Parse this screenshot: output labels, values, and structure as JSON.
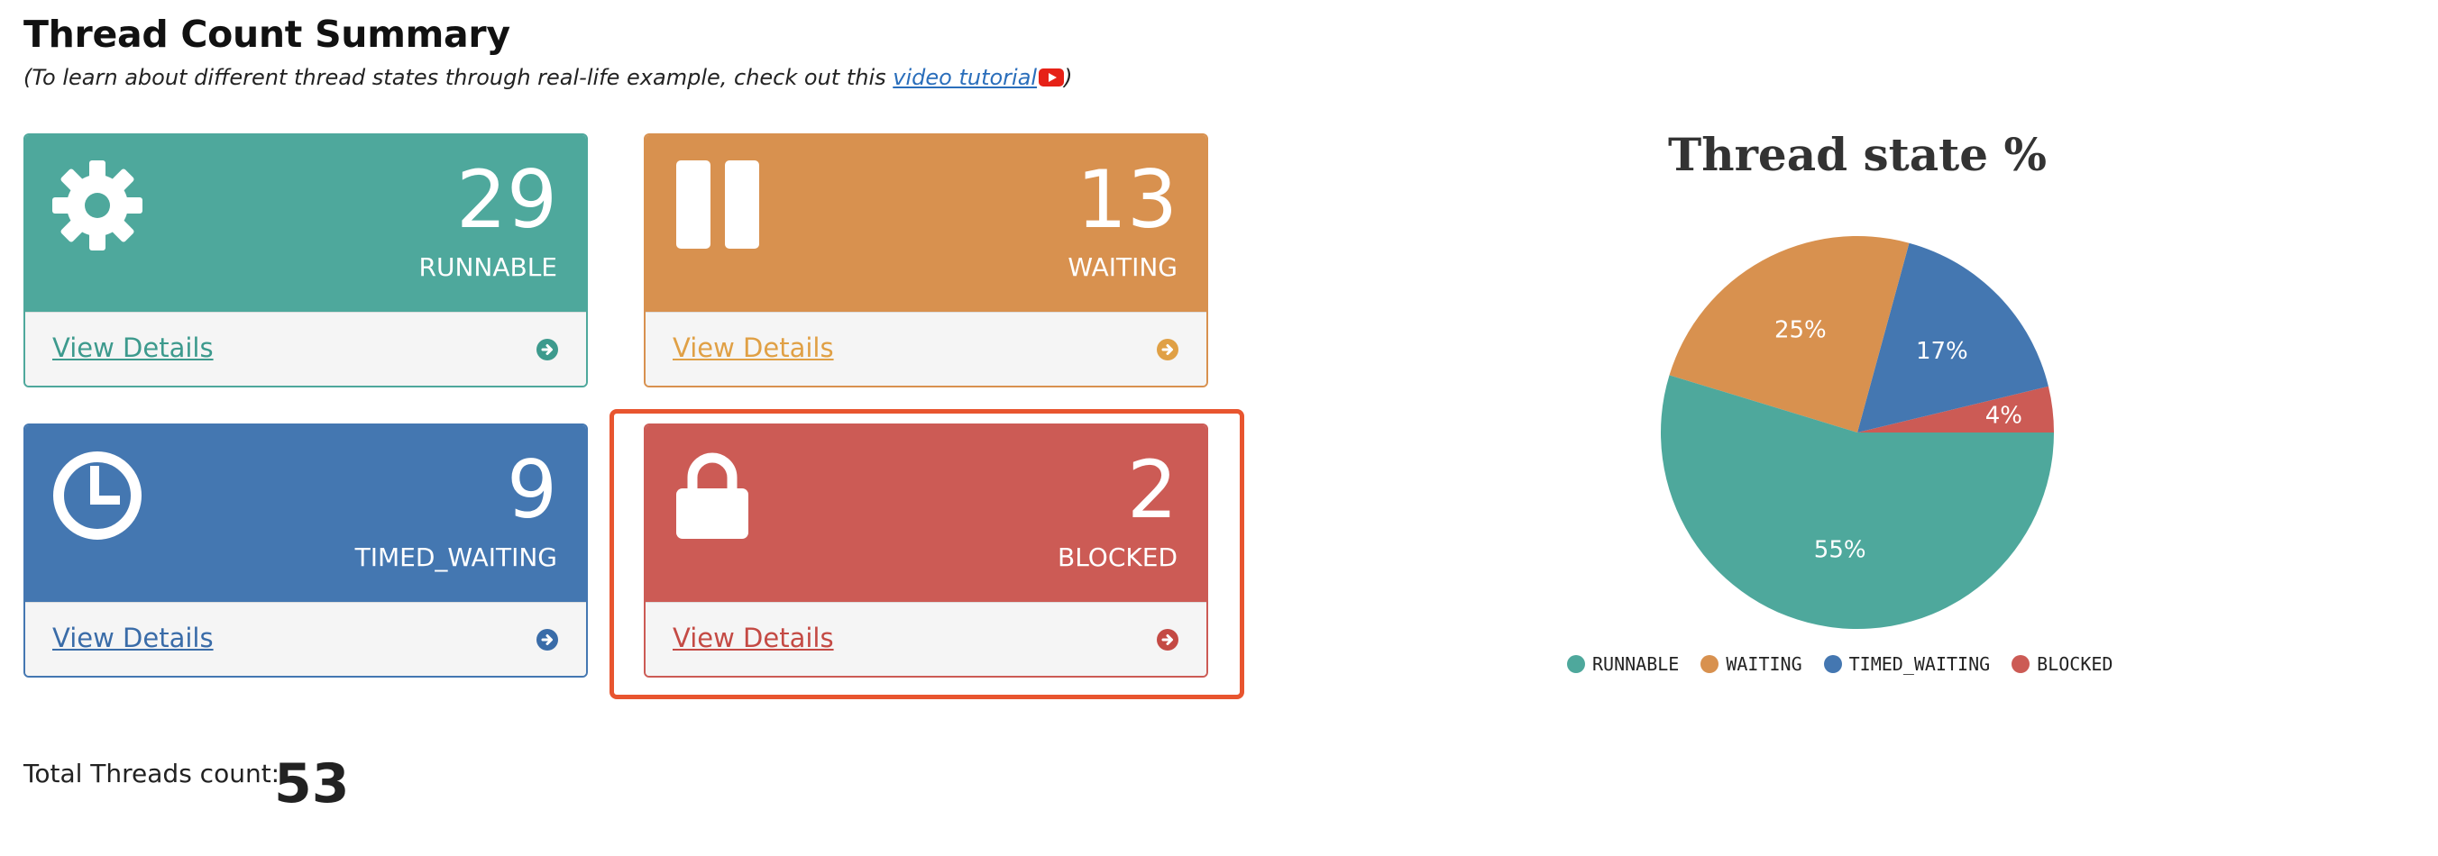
{
  "header": {
    "title": "Thread Count Summary",
    "subtitle_prefix": "(To learn about different thread states through real-life example, check out this ",
    "subtitle_link": "video tutorial",
    "subtitle_suffix": ")"
  },
  "cards": {
    "runnable": {
      "count": "29",
      "state": "RUNNABLE",
      "link": "View Details",
      "color": "#4ea89c",
      "icon": "gear-icon"
    },
    "waiting": {
      "count": "13",
      "state": "WAITING",
      "link": "View Details",
      "color": "#d8914f",
      "icon": "pause-icon"
    },
    "timed_waiting": {
      "count": "9",
      "state": "TIMED_WAITING",
      "link": "View Details",
      "color": "#4477b1",
      "icon": "clock-icon"
    },
    "blocked": {
      "count": "2",
      "state": "BLOCKED",
      "link": "View Details",
      "color": "#cc5b55",
      "icon": "lock-icon"
    }
  },
  "total": {
    "label": "Total Threads count:",
    "value": "53"
  },
  "chart_data": {
    "type": "pie",
    "title": "Thread state %",
    "categories": [
      "RUNNABLE",
      "WAITING",
      "TIMED_WAITING",
      "BLOCKED"
    ],
    "values": [
      29,
      13,
      9,
      2
    ],
    "labels": [
      "55%",
      "25%",
      "17%",
      "4%"
    ],
    "colors": [
      "#4ea89c",
      "#d8914f",
      "#4477b1",
      "#cc5b55"
    ],
    "legend_position": "bottom"
  }
}
